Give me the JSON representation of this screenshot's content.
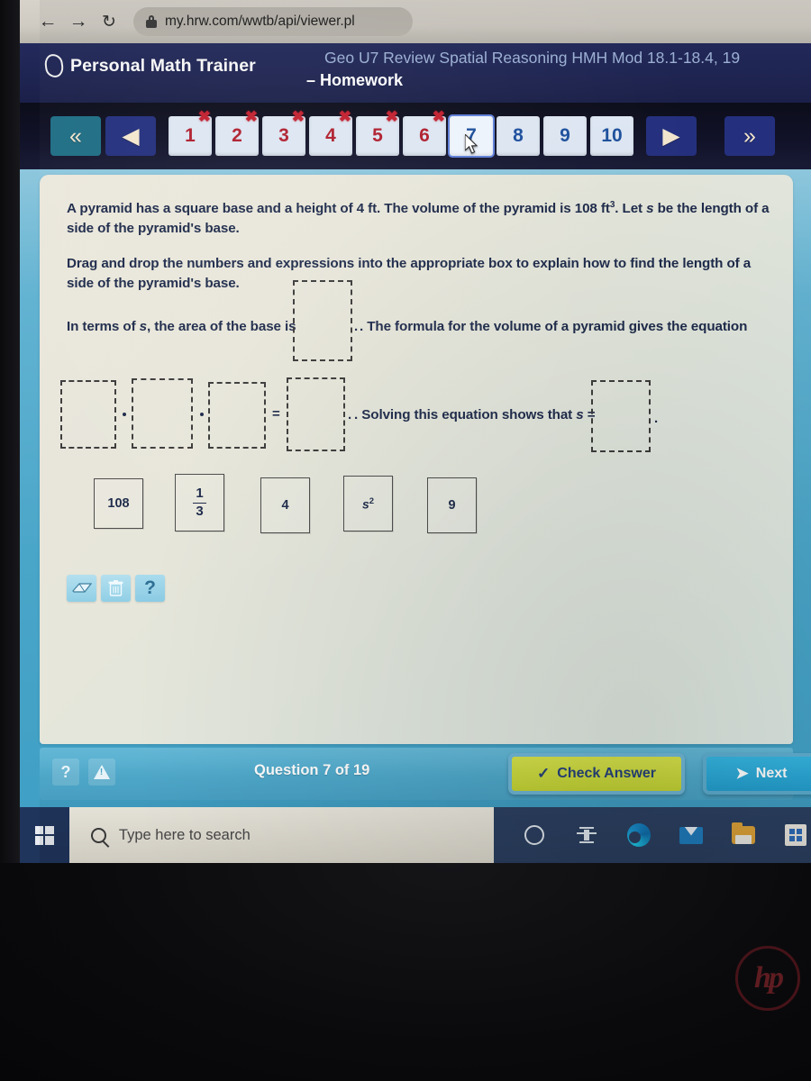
{
  "browser": {
    "back_icon": "arrow-left-icon",
    "forward_icon": "arrow-right-icon",
    "reload_icon": "reload-icon",
    "lock_icon": "lock-icon",
    "url": "my.hrw.com/wwtb/api/viewer.pl"
  },
  "header": {
    "brand": "Personal Math Trainer",
    "brand_mark": "pmt-leaf-logo",
    "assignment_title": "Geo U7 Review Spatial Reasoning HMH Mod 18.1-18.4, 19",
    "assignment_subtitle": "– Homework"
  },
  "qnav": {
    "first_label": "«",
    "prev_label": "◀",
    "next_label": "▶",
    "last_label": "»",
    "questions": [
      {
        "label": "1",
        "state": "wrong"
      },
      {
        "label": "2",
        "state": "wrong"
      },
      {
        "label": "3",
        "state": "wrong"
      },
      {
        "label": "4",
        "state": "wrong"
      },
      {
        "label": "5",
        "state": "wrong"
      },
      {
        "label": "6",
        "state": "wrong"
      },
      {
        "label": "7",
        "state": "current"
      },
      {
        "label": "8",
        "state": "pending"
      },
      {
        "label": "9",
        "state": "pending"
      },
      {
        "label": "10",
        "state": "pending"
      }
    ],
    "wrong_mark": "✖"
  },
  "question": {
    "prompt_line1": "A pyramid has a square base and a height of 4 ft. The volume of the pyramid is 108 ft",
    "prompt_exponent": "3",
    "prompt_line1b": ". Let ",
    "prompt_var": "s",
    "prompt_line1c": " be the length of a side of the pyramid's base.",
    "prompt_line2": "Drag and drop the numbers and expressions into the appropriate box to explain how to find the length of a side of the pyramid's base.",
    "sentence_1a": "In terms of ",
    "sentence_1var": "s",
    "sentence_1b": ", the area of the base is",
    "sentence_2": ". The formula for the volume of a pyramid gives the equation",
    "sentence_3": ". Solving this equation shows that ",
    "sentence_3var": "s",
    "sentence_3eq": " =",
    "trailing_period": ".",
    "operator_dot": "·",
    "equals": "=",
    "dropzones": [
      {
        "name": "area-of-base-dropzone",
        "value": ""
      },
      {
        "name": "equation-factor-1-dropzone",
        "value": ""
      },
      {
        "name": "equation-factor-2-dropzone",
        "value": ""
      },
      {
        "name": "equation-factor-3-dropzone",
        "value": ""
      },
      {
        "name": "equation-result-dropzone",
        "value": ""
      },
      {
        "name": "solution-s-dropzone",
        "value": ""
      }
    ],
    "tiles": [
      {
        "name": "tile-108",
        "type": "plain",
        "label": "108"
      },
      {
        "name": "tile-one-third",
        "type": "fraction",
        "numerator": "1",
        "denominator": "3"
      },
      {
        "name": "tile-4",
        "type": "plain",
        "label": "4"
      },
      {
        "name": "tile-s-squared",
        "type": "power",
        "base": "s",
        "exponent": "2"
      },
      {
        "name": "tile-9",
        "type": "plain",
        "label": "9"
      }
    ],
    "tools": [
      {
        "name": "eraser-tool-button",
        "icon": "eraser-icon",
        "label": ""
      },
      {
        "name": "trash-tool-button",
        "icon": "trash-icon",
        "label": ""
      },
      {
        "name": "help-tool-button",
        "icon": "question-mark-icon",
        "label": "?"
      }
    ]
  },
  "action_bar": {
    "help_label": "?",
    "help_icon": "question-mark-icon",
    "warning_icon": "warning-triangle-icon",
    "counter": "Question 7 of 19",
    "check_answer_label": "Check Answer",
    "check_answer_icon": "checkmark-icon",
    "next_label": "Next",
    "next_icon": "arrow-right-icon"
  },
  "taskbar": {
    "start_icon": "windows-start-icon",
    "search_icon": "search-icon",
    "search_placeholder": "Type here to search",
    "search_value": "",
    "icons": [
      {
        "name": "cortana-icon"
      },
      {
        "name": "task-view-icon"
      },
      {
        "name": "microsoft-edge-icon"
      },
      {
        "name": "mail-icon"
      },
      {
        "name": "file-explorer-icon"
      },
      {
        "name": "microsoft-store-icon"
      }
    ]
  },
  "device": {
    "vendor_logo": "hp-logo",
    "vendor_text": "hp"
  },
  "colors": {
    "header_navy": "#232a5c",
    "body_blue": "#4aa6c9",
    "card_cream": "#e7e6da",
    "wrong_red": "#b01f2e",
    "pending_blue": "#1d4f9c",
    "check_green": "#c4d434",
    "next_cyan": "#23a0d0"
  }
}
